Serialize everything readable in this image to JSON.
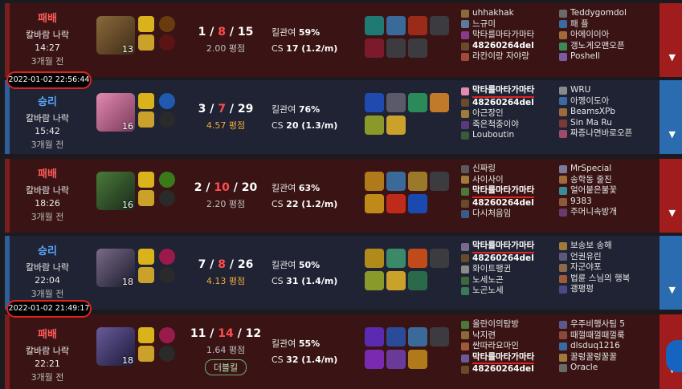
{
  "colors": {
    "loss_bg": "#3a1414",
    "win_bg": "#1f2333",
    "loss_text": "#ff5a5a",
    "win_text": "#5aa8ff",
    "deaths": "#ff4d4d",
    "highlight": "#e0221f"
  },
  "timestamps": [
    "2022-01-02 22:56:44",
    "2022-01-02 21:49:17"
  ],
  "matches": [
    {
      "result": "패배",
      "mode": "칼바람 나락",
      "duration": "14:27",
      "ago": "3개월 전",
      "champ_level": "13",
      "kills": "1",
      "deaths": "8",
      "assists": "15",
      "ratio": "2.00 평점",
      "kp_label": "킬관여",
      "kp": "59%",
      "cs_label": "CS",
      "cs": "17 (1.2/m)",
      "team_a": [
        "uhhakhak",
        "느규미",
        "막타를마타가마타",
        "48260264del",
        "라칸이랑 자야랑"
      ],
      "team_b": [
        "Teddygomdol",
        "패 플",
        "아에이이아",
        "갱노게오맨오픈",
        "Poshell"
      ]
    },
    {
      "result": "승리",
      "mode": "칼바람 나락",
      "duration": "15:42",
      "ago": "3개월 전",
      "champ_level": "16",
      "kills": "3",
      "deaths": "7",
      "assists": "29",
      "ratio": "4.57 평점",
      "kp_label": "킬관여",
      "kp": "76%",
      "cs_label": "CS",
      "cs": "20 (1.3/m)",
      "team_a": [
        "막타를마타가마타",
        "48260264del",
        "아근장인",
        "죽은척중이야",
        "Louboutin"
      ],
      "team_b": [
        "WRU",
        "아껭이도아",
        "BeamsXPb",
        "Sin Ma Ru",
        "짜증나면바로오픈"
      ]
    },
    {
      "result": "패배",
      "mode": "칼바람 나락",
      "duration": "18:26",
      "ago": "3개월 전",
      "champ_level": "16",
      "kills": "2",
      "deaths": "10",
      "assists": "20",
      "ratio": "2.20 평점",
      "kp_label": "킬관여",
      "kp": "63%",
      "cs_label": "CS",
      "cs": "22 (1.2/m)",
      "team_a": [
        "신짜링",
        "사이사이",
        "막타를마타가마타",
        "48260264del",
        "다시처음임"
      ],
      "team_b": [
        "MrSpecial",
        "송학동 줄진",
        "얼어붙은불꽃",
        "9383",
        "주머니속방개"
      ]
    },
    {
      "result": "승리",
      "mode": "칼바람 나락",
      "duration": "22:04",
      "ago": "3개월 전",
      "champ_level": "18",
      "kills": "7",
      "deaths": "8",
      "assists": "26",
      "ratio": "4.13 평점",
      "kp_label": "킬관여",
      "kp": "50%",
      "cs_label": "CS",
      "cs": "31 (1.4/m)",
      "team_a": [
        "막타를마타가마타",
        "48260264del",
        "화이트팽귄",
        "노세노곤",
        "노곤노세"
      ],
      "team_b": [
        "보송보 송해",
        "언권유린",
        "자군야포",
        "법륜 스님의 행복",
        "괭팽펑"
      ]
    },
    {
      "result": "패배",
      "mode": "칼바람 나락",
      "duration": "22:21",
      "ago": "3개월 전",
      "champ_level": "18",
      "kills": "11",
      "deaths": "14",
      "assists": "12",
      "ratio": "1.64 평점",
      "badge": "더블킬",
      "kp_label": "킬관여",
      "kp": "55%",
      "cs_label": "CS",
      "cs": "32 (1.4/m)",
      "team_a": [
        "올란이의탐방",
        "낙지련",
        "싼따라요마인",
        "막타를마타가마타",
        "48260264del"
      ],
      "team_b": [
        "우주비행사팀 5",
        "때껄때껄때껄룩",
        "dlsduq1216",
        "꿀렁꿀렁꿀꿀",
        "Oracle"
      ]
    }
  ]
}
